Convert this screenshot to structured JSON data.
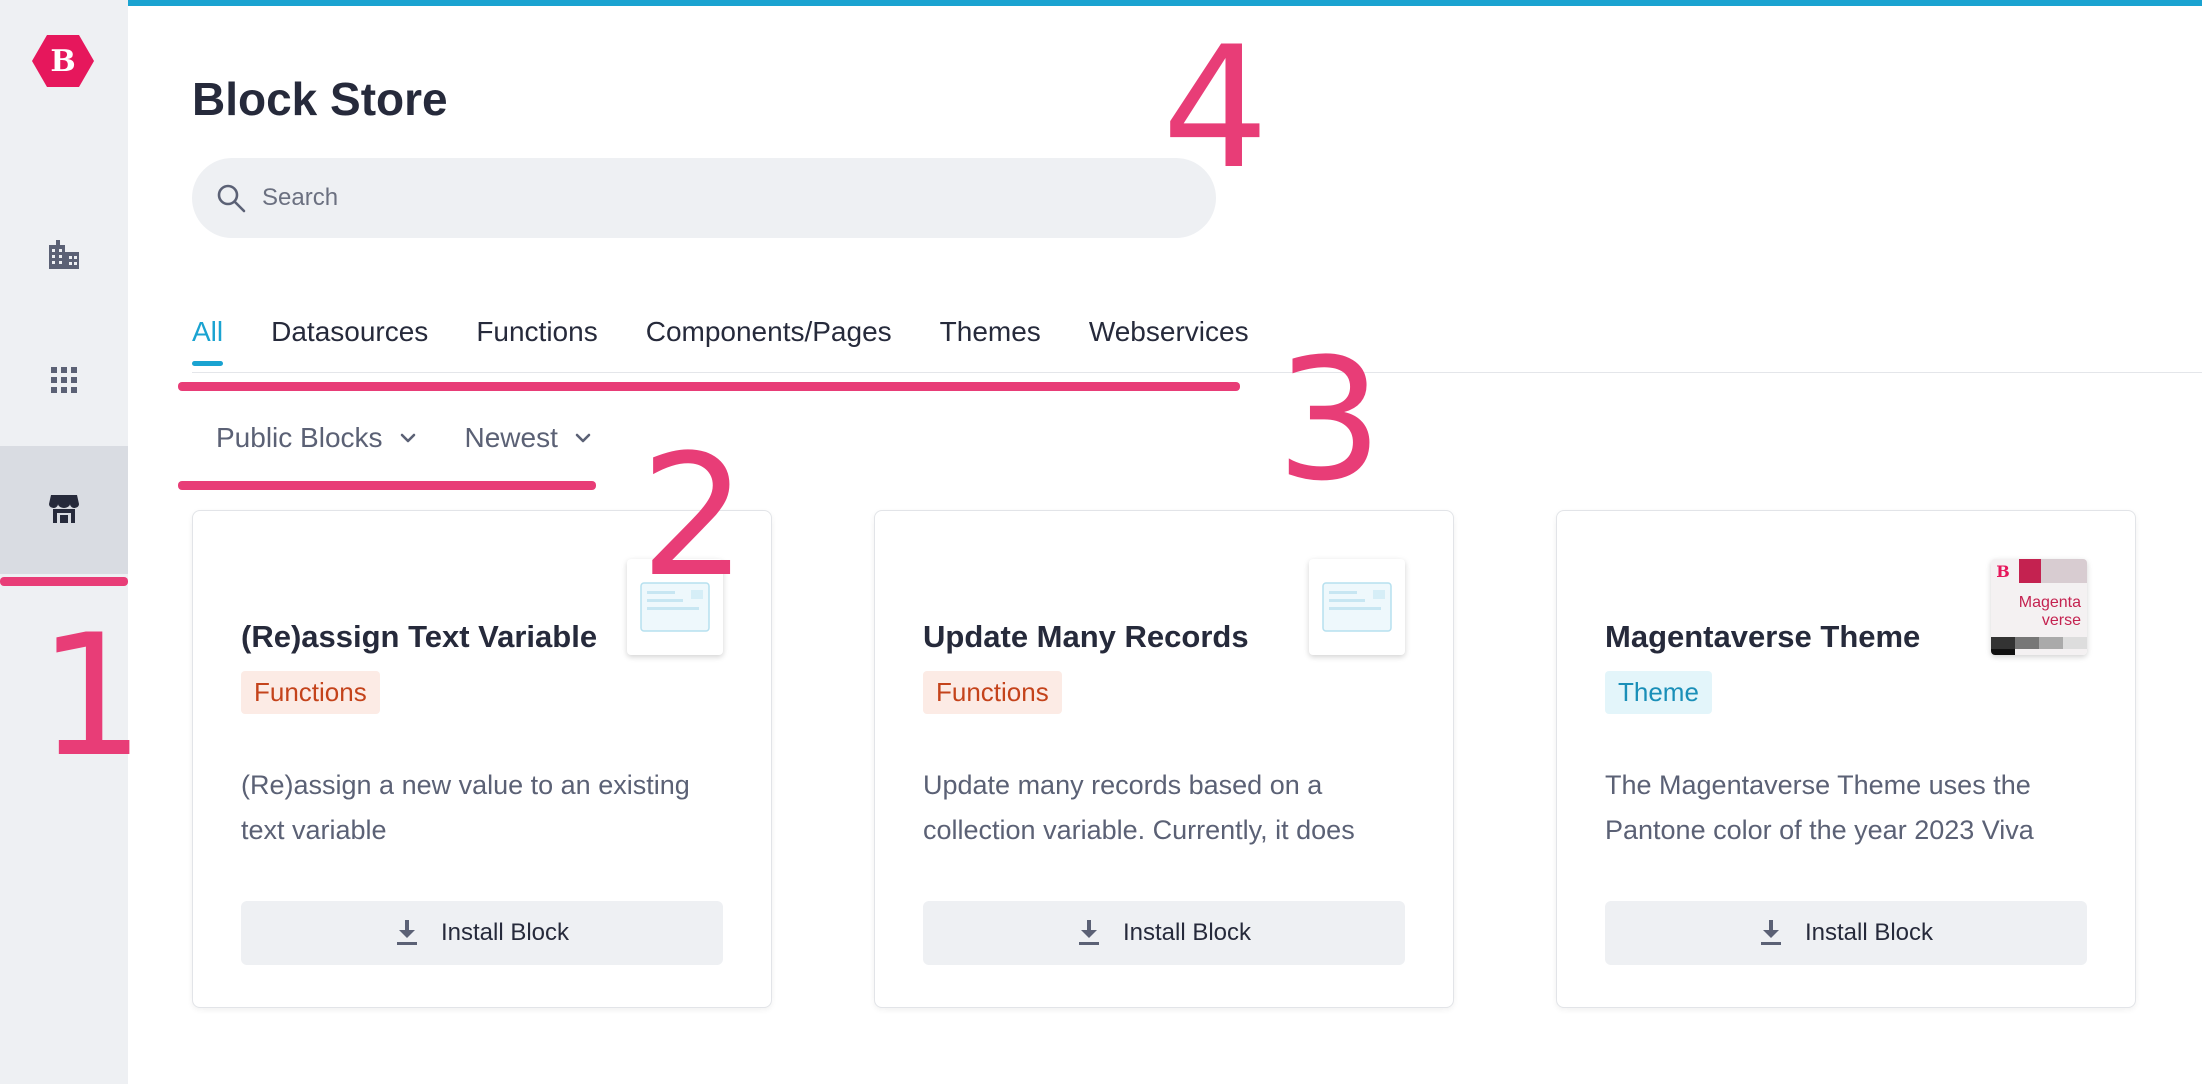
{
  "sidebar": {
    "logo_letter": "B",
    "items": [
      {
        "icon": "building-icon"
      },
      {
        "icon": "apps-grid-icon"
      },
      {
        "icon": "store-icon",
        "active": true
      }
    ]
  },
  "header": {
    "title": "Block Store"
  },
  "search": {
    "placeholder": "Search",
    "value": ""
  },
  "tabs": [
    {
      "label": "All",
      "active": true
    },
    {
      "label": "Datasources"
    },
    {
      "label": "Functions"
    },
    {
      "label": "Components/Pages"
    },
    {
      "label": "Themes"
    },
    {
      "label": "Webservices"
    }
  ],
  "filters": {
    "visibility": "Public Blocks",
    "sort": "Newest"
  },
  "cards": [
    {
      "title": "(Re)assign Text Variable",
      "badge": "Functions",
      "description": "(Re)assign a new value to an existing text variable",
      "button": "Install Block"
    },
    {
      "title": "Update Many Records",
      "badge": "Functions",
      "description": "Update many records based on a collection variable. Currently, it does",
      "button": "Install Block"
    },
    {
      "title": "Magentaverse Theme",
      "badge": "Theme",
      "description": "The Magentaverse Theme uses the Pantone color of the year 2023 Viva",
      "button": "Install Block",
      "thumb_text_1": "Magenta",
      "thumb_text_2": "verse",
      "thumb_logo": "B"
    }
  ],
  "annotations": [
    "1",
    "2",
    "3",
    "4"
  ],
  "colors": {
    "accent": "#1aa3d1",
    "annotation": "#e83d77",
    "brand": "#e6175c",
    "functions_badge_text": "#c4431b",
    "theme_badge_text": "#1a8fb8"
  }
}
